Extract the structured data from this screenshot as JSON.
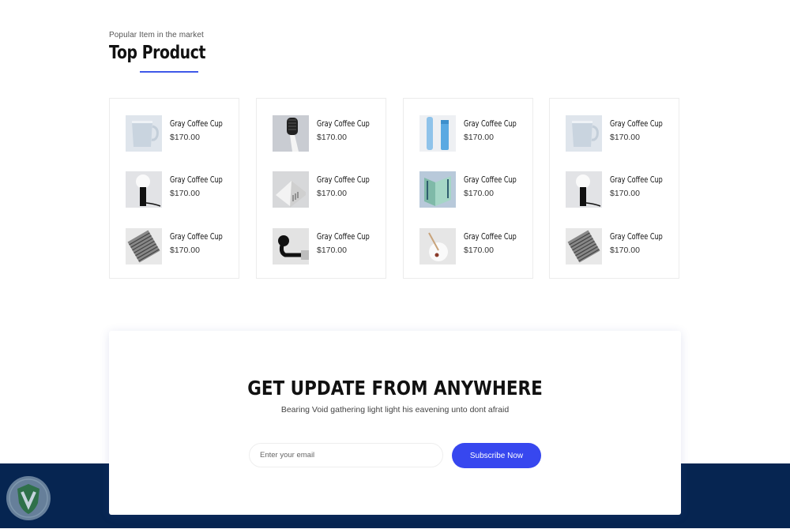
{
  "section": {
    "eyebrow": "Popular Item in the market",
    "title": "Top Product"
  },
  "products": [
    {
      "items": [
        {
          "name": "Gray Coffee Cup",
          "price": "$170.00",
          "image": "cup-icon"
        },
        {
          "name": "Gray Coffee Cup",
          "price": "$170.00",
          "image": "lamp-icon"
        },
        {
          "name": "Gray Coffee Cup",
          "price": "$170.00",
          "image": "pattern-tile-icon"
        }
      ]
    },
    {
      "items": [
        {
          "name": "Gray Coffee Cup",
          "price": "$170.00",
          "image": "toothbrush-icon"
        },
        {
          "name": "Gray Coffee Cup",
          "price": "$170.00",
          "image": "soap-dish-icon"
        },
        {
          "name": "Gray Coffee Cup",
          "price": "$170.00",
          "image": "towel-hook-icon"
        }
      ]
    },
    {
      "items": [
        {
          "name": "Gray Coffee Cup",
          "price": "$170.00",
          "image": "tube-bottle-icon"
        },
        {
          "name": "Gray Coffee Cup",
          "price": "$170.00",
          "image": "book-stand-icon"
        },
        {
          "name": "Gray Coffee Cup",
          "price": "$170.00",
          "image": "desk-lamp-icon"
        }
      ]
    },
    {
      "items": [
        {
          "name": "Gray Coffee Cup",
          "price": "$170.00",
          "image": "cup-icon"
        },
        {
          "name": "Gray Coffee Cup",
          "price": "$170.00",
          "image": "lamp-icon"
        },
        {
          "name": "Gray Coffee Cup",
          "price": "$170.00",
          "image": "pattern-tile-icon"
        }
      ]
    }
  ],
  "newsletter": {
    "title": "GET UPDATE FROM ANYWHERE",
    "subtitle": "Bearing Void gathering light light his eavening unto dont afraid",
    "email_placeholder": "Enter your email",
    "button_label": "Subscribe Now"
  },
  "colors": {
    "accent": "#3747ef",
    "footer": "#062551",
    "underline": "#3f58e8"
  }
}
